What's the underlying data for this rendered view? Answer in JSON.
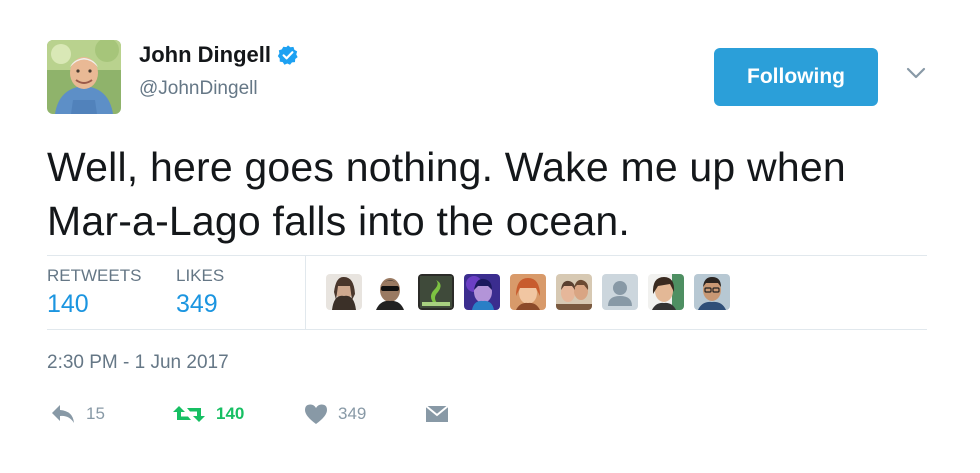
{
  "author": {
    "name": "John Dingell",
    "handle": "@JohnDingell",
    "verified": true,
    "avatar_icon": "user-avatar"
  },
  "follow_button": {
    "label": "Following",
    "color": "#2b9fd9"
  },
  "menu_icon": "chevron-down-icon",
  "tweet": {
    "lines": [
      "Well, here goes nothing. Wake me up when",
      "Mar-a-Lago falls into the ocean."
    ]
  },
  "stats": {
    "retweets_label": "RETWEETS",
    "retweets_count": "140",
    "likes_label": "LIKES",
    "likes_count": "349"
  },
  "likers": [
    "liker-avatar-1",
    "liker-avatar-2",
    "liker-avatar-3",
    "liker-avatar-4",
    "liker-avatar-5",
    "liker-avatar-6",
    "liker-avatar-7",
    "liker-avatar-8",
    "liker-avatar-9"
  ],
  "timestamp": "2:30 PM - 1 Jun 2017",
  "actions": {
    "reply_count": "15",
    "retweet_count": "140",
    "like_count": "349"
  },
  "colors": {
    "link_blue": "#1b95e0",
    "muted": "#657786",
    "retweet_green": "#17bf63",
    "verified_blue": "#1da1f2"
  }
}
